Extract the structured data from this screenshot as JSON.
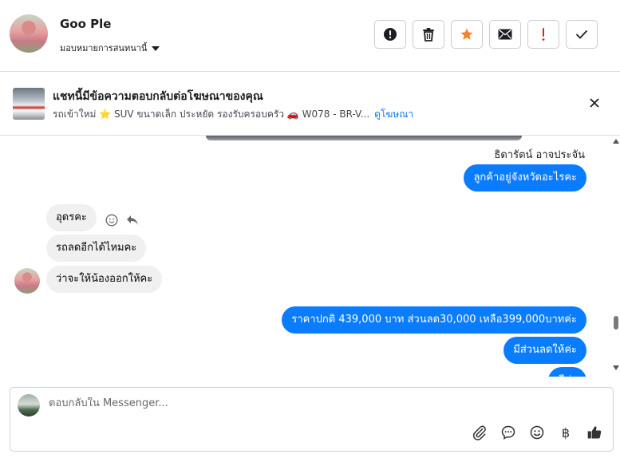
{
  "header": {
    "contact_name": "Goo Ple",
    "label_select": "มอบหมายการสนทนานี้",
    "actions": [
      {
        "name": "report-icon"
      },
      {
        "name": "trash-icon"
      },
      {
        "name": "star-icon"
      },
      {
        "name": "mail-icon"
      },
      {
        "name": "exclamation-icon"
      },
      {
        "name": "check-icon"
      }
    ]
  },
  "banner": {
    "title": "แชทนี้มีข้อความตอบกลับต่อโฆษณาของคุณ",
    "subtitle": "รถเข้าใหม่ ⭐ SUV ขนาดเล็ก ประหยัด รองรับครอบครัว 🚗 W078 - BR-V...",
    "link": "ดูโฆษณา"
  },
  "chat": {
    "sender_name": "ธิดารัตน์ อาจประจัน",
    "messages": [
      {
        "side": "out",
        "text": "ลูกค้าอยู่จังหวัดอะไรคะ"
      },
      {
        "side": "in",
        "text": "อุดรคะ"
      },
      {
        "side": "in",
        "text": "รถลดอีกได้ไหมคะ"
      },
      {
        "side": "in",
        "text": "ว่าจะให้น้องออกให้คะ"
      },
      {
        "side": "out",
        "text": "ราคาปกติ 439,000 บาท ส่วนลด30,000 เหลือ399,000บาทค่ะ"
      },
      {
        "side": "out",
        "text": "มีส่วนลดให้ค่ะ"
      },
      {
        "side": "out",
        "text": "มีค่ะ"
      }
    ]
  },
  "composer": {
    "placeholder": "ตอบกลับใน Messenger...",
    "tools": [
      "paperclip-icon",
      "chat-bubble-icon",
      "emoji-icon",
      "baht-icon",
      "thumbs-up-icon"
    ],
    "baht_symbol": "฿"
  },
  "colors": {
    "accent": "#0a7cff",
    "star": "#f5822a",
    "alert": "#e02020"
  }
}
